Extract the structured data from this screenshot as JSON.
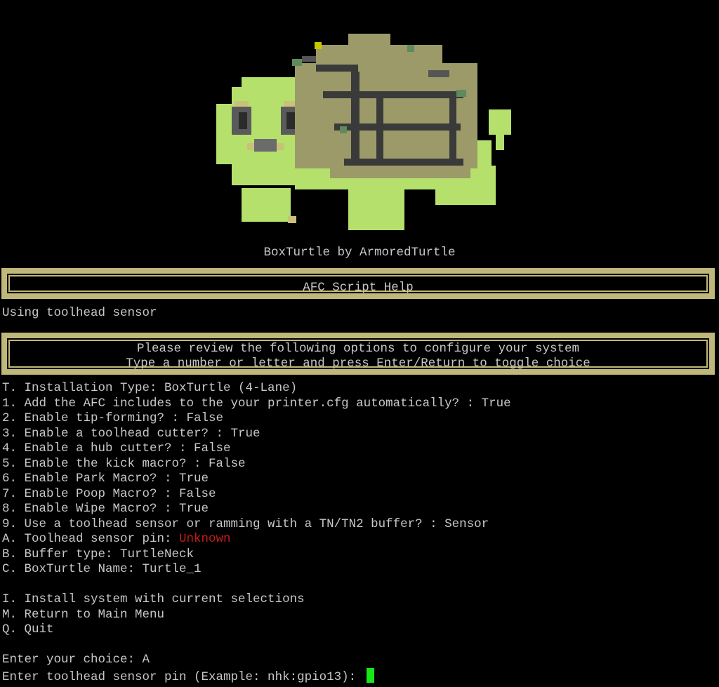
{
  "banner": {
    "caption": "BoxTurtle by ArmoredTurtle",
    "logo_icon": "turtle-pixel-art"
  },
  "help_title": "AFC Script Help",
  "status_line": "Using toolhead sensor",
  "instructions": {
    "line1": "Please review the following options to configure your system",
    "line2": "Type a number or letter and press Enter/Return to toggle choice"
  },
  "options": [
    {
      "text": "T. Installation Type: BoxTurtle (4-Lane)"
    },
    {
      "text": "1. Add the AFC includes to the your printer.cfg automatically? : True"
    },
    {
      "text": "2. Enable tip-forming? : False"
    },
    {
      "text": "3. Enable a toolhead cutter? : True"
    },
    {
      "text": "4. Enable a hub cutter? : False"
    },
    {
      "text": "5. Enable the kick macro? : False"
    },
    {
      "text": "6. Enable Park Macro? : True"
    },
    {
      "text": "7. Enable Poop Macro? : False"
    },
    {
      "text": "8. Enable Wipe Macro? : True"
    },
    {
      "text": "9. Use a toolhead sensor or ramming with a TN/TN2 buffer? : Sensor"
    },
    {
      "text": "A. Toolhead sensor pin: ",
      "value": "Unknown"
    },
    {
      "text": "B. Buffer type: TurtleNeck"
    },
    {
      "text": "C. BoxTurtle Name: Turtle_1"
    }
  ],
  "actions": [
    {
      "text": "I. Install system with current selections"
    },
    {
      "text": "M. Return to Main Menu"
    },
    {
      "text": "Q. Quit"
    }
  ],
  "prompt": {
    "choice_line": "Enter your choice: A",
    "input_label": "Enter toolhead sensor pin (Example: nhk:gpio13): ",
    "input_value": ""
  },
  "colors": {
    "background": "#000000",
    "text": "#c8c8c8",
    "border": "#bfb87a",
    "warning": "#c41b16",
    "cursor": "#17e617",
    "turtle_body": "#b5e06b",
    "turtle_shell": "#9c9a68"
  }
}
